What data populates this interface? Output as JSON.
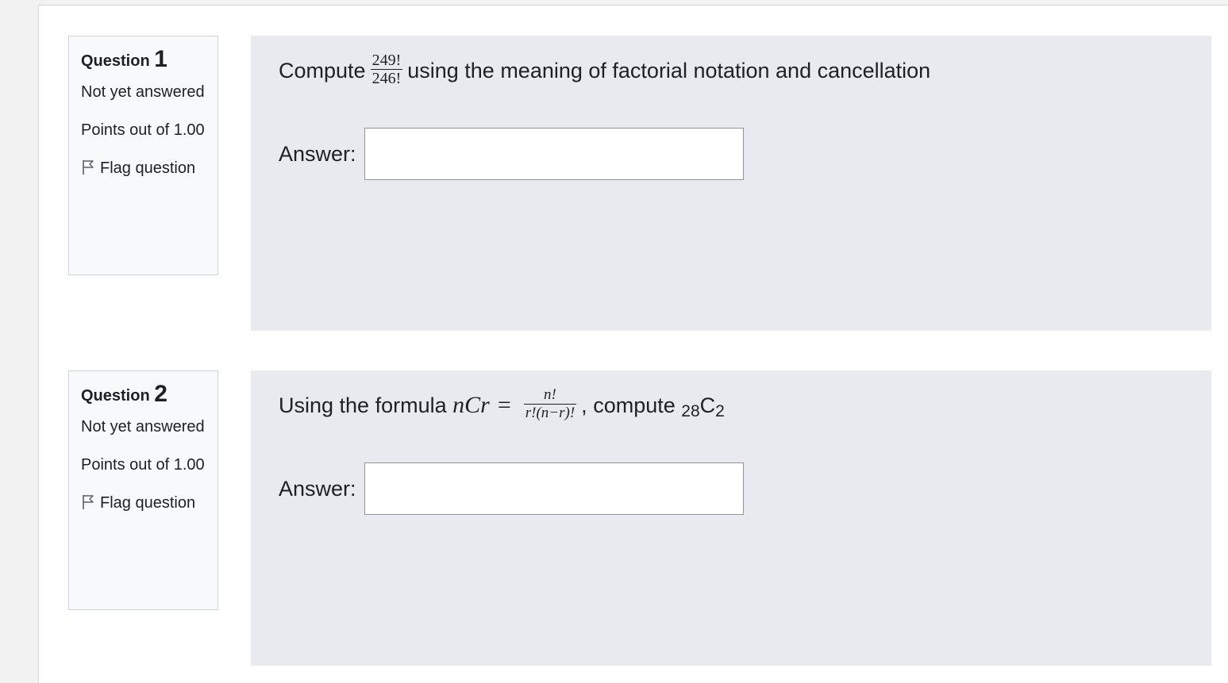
{
  "questions": [
    {
      "label": "Question",
      "number": "1",
      "state": "Not yet answered",
      "grade": "Points out of 1.00",
      "flag_label": "Flag question",
      "text_before": "Compute",
      "fraction_numerator": "249!",
      "fraction_denominator": "246!",
      "text_after": "using the meaning of factorial notation and cancellation",
      "answer_label": "Answer:",
      "answer_value": ""
    },
    {
      "label": "Question",
      "number": "2",
      "state": "Not yet answered",
      "grade": "Points out of 1.00",
      "flag_label": "Flag question",
      "text_before": "Using the formula",
      "math_lhs": "nCr",
      "math_eq": "=",
      "fraction_numerator": "n!",
      "fraction_denominator": "r!(n−r)!",
      "text_comma": ",",
      "text_compute": "compute",
      "sub_left": "28",
      "combo_letter": "C",
      "sub_right": "2",
      "answer_label": "Answer:",
      "answer_value": ""
    }
  ],
  "icons": {
    "flag": "flag-outline-icon"
  }
}
